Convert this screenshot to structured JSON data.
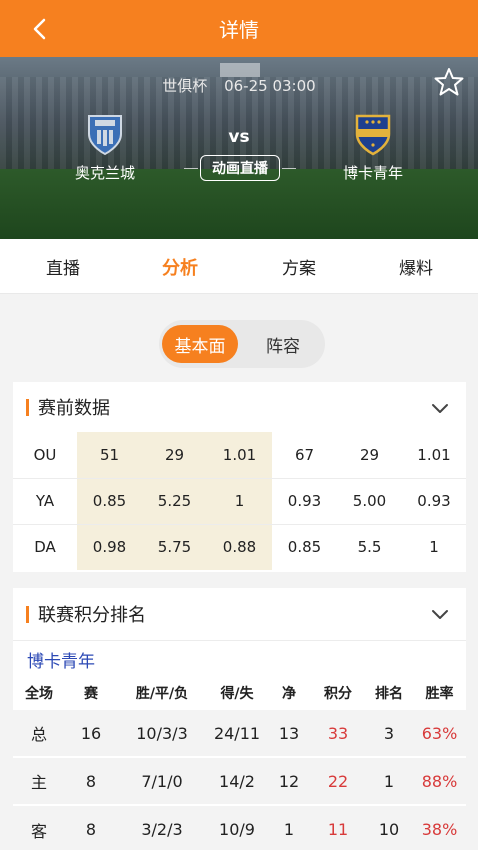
{
  "topbar": {
    "title": "详情"
  },
  "hero": {
    "competition": "世俱杯",
    "datetime": "06-25 03:00",
    "home_team": "奥克兰城",
    "away_team": "博卡青年",
    "vs": "vs",
    "live_button": "动画直播"
  },
  "tabs": [
    {
      "label": "直播",
      "active": false
    },
    {
      "label": "分析",
      "active": true
    },
    {
      "label": "方案",
      "active": false
    },
    {
      "label": "爆料",
      "active": false
    }
  ],
  "segment": {
    "selected": "基本面",
    "other": "阵容"
  },
  "prematch": {
    "title": "赛前数据",
    "rows": [
      [
        "OU",
        "51",
        "29",
        "1.01",
        "67",
        "29",
        "1.01"
      ],
      [
        "YA",
        "0.85",
        "5.25",
        "1",
        "0.93",
        "5.00",
        "0.93"
      ],
      [
        "DA",
        "0.98",
        "5.75",
        "0.88",
        "0.85",
        "5.5",
        "1"
      ]
    ]
  },
  "standings": {
    "title": "联赛积分排名",
    "team": "博卡青年",
    "headers": [
      "全场",
      "赛",
      "胜/平/负",
      "得/失",
      "净",
      "积分",
      "排名",
      "胜率"
    ],
    "rows": [
      [
        "总",
        "16",
        "10/3/3",
        "24/11",
        "13",
        "33",
        "3",
        "63%"
      ],
      [
        "主",
        "8",
        "7/1/0",
        "14/2",
        "12",
        "22",
        "1",
        "88%"
      ],
      [
        "客",
        "8",
        "3/2/3",
        "10/9",
        "1",
        "11",
        "10",
        "38%"
      ]
    ]
  },
  "colors": {
    "accent": "#f6801f",
    "highlight": "#f5efdc",
    "red": "#d83a3a",
    "team_blue": "#2c49b5"
  }
}
